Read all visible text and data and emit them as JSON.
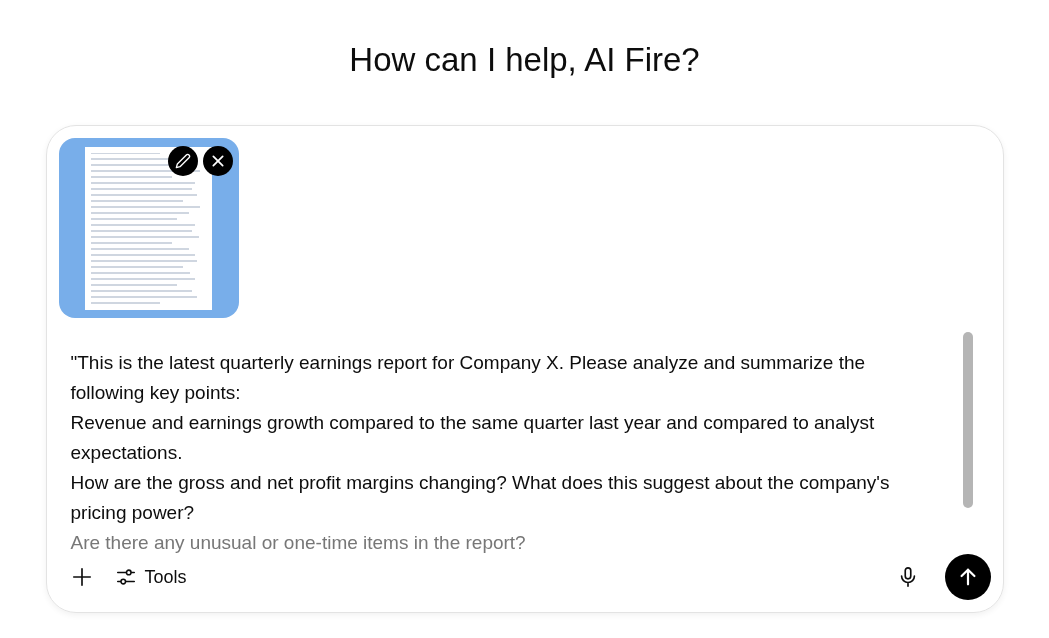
{
  "heading": "How can I help, AI Fire?",
  "attachment": {
    "kind": "image"
  },
  "prompt": {
    "lines": [
      "\"This is the latest quarterly earnings report for Company X. Please analyze and summarize the",
      "following key points:",
      "Revenue and earnings growth compared to the same quarter last year and compared to analyst",
      "expectations.",
      "How are the gross and net profit margins changing? What does this suggest about the company's",
      "pricing power?",
      "Are there any unusual or one-time items in the report?"
    ]
  },
  "toolbar": {
    "tools_label": "Tools"
  }
}
